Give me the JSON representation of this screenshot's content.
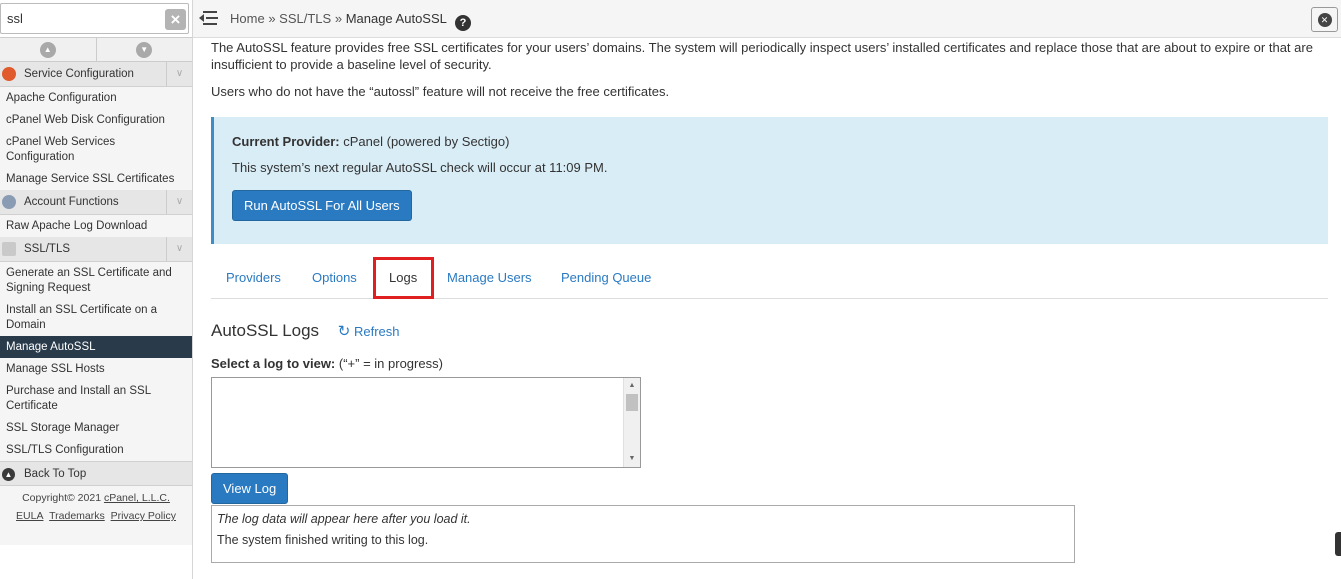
{
  "search": {
    "value": "ssl",
    "clear_icon": "x-icon"
  },
  "sidebar": {
    "groups": [
      {
        "label": "Service Configuration",
        "icon": "wrench-icon",
        "icon_color": "#e05a2b",
        "items": [
          "Apache Configuration",
          "cPanel Web Disk Configuration",
          "cPanel Web Services Configuration",
          "Manage Service SSL Certificates"
        ]
      },
      {
        "label": "Account Functions",
        "icon": "user-icon",
        "icon_color": "#8a9bb4",
        "items": [
          "Raw Apache Log Download"
        ]
      },
      {
        "label": "SSL/TLS",
        "icon": "certificate-icon",
        "icon_color": "#b9b9b9",
        "items": [
          "Generate an SSL Certificate and Signing Request",
          "Install an SSL Certificate on a Domain",
          "Manage AutoSSL",
          "Manage SSL Hosts",
          "Purchase and Install an SSL Certificate",
          "SSL Storage Manager",
          "SSL/TLS Configuration"
        ]
      }
    ],
    "back_to_top": "Back To Top",
    "footer": {
      "copyright": "Copyright© 2021",
      "company": "cPanel, L.L.C.",
      "eula": "EULA",
      "trademarks": "Trademarks",
      "privacy": "Privacy Policy"
    }
  },
  "breadcrumb": {
    "home": "Home",
    "sep": "»",
    "section": "SSL/TLS",
    "current": "Manage AutoSSL"
  },
  "intro": {
    "p1": "The AutoSSL feature provides free SSL certificates for your users’ domains. The system will periodically inspect users’ installed certificates and replace those that are about to expire or that are insufficient to provide a baseline level of security.",
    "p2": "Users who do not have the “autossl” feature will not receive the free certificates."
  },
  "provider": {
    "label": "Current Provider:",
    "name": "cPanel (powered by Sectigo)",
    "next_check": "This system’s next regular AutoSSL check will occur at 11:09 PM.",
    "run_button": "Run AutoSSL For All Users"
  },
  "tabs": [
    "Providers",
    "Options",
    "Logs",
    "Manage Users",
    "Pending Queue"
  ],
  "active_tab": "Logs",
  "logs": {
    "title": "AutoSSL Logs",
    "refresh": "Refresh",
    "select_label": "Select a log to view:",
    "select_hint": "(“+” = in progress)",
    "view_button": "View Log",
    "output_hint": "The log data will appear here after you load it.",
    "output_status": "The system finished writing to this log."
  },
  "colors": {
    "accent": "#2a7ac2",
    "active_nav": "#293a4a",
    "highlight": "#e02020",
    "info_bg": "#d9edf7"
  }
}
